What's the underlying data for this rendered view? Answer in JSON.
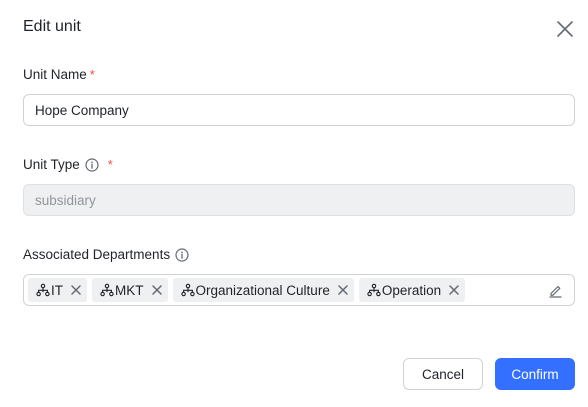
{
  "dialog": {
    "title": "Edit unit",
    "close_icon": "close-icon"
  },
  "unit_name": {
    "label": "Unit Name",
    "required_mark": "*",
    "value": "Hope Company"
  },
  "unit_type": {
    "label": "Unit Type",
    "required_mark": "*",
    "info_icon": "info-icon",
    "value": "subsidiary"
  },
  "associated_departments": {
    "label": "Associated Departments",
    "info_icon": "info-icon",
    "tags": [
      {
        "label": "IT",
        "icon": "department-icon"
      },
      {
        "label": "MKT",
        "icon": "department-icon"
      },
      {
        "label": "Organizational Culture",
        "icon": "department-icon"
      },
      {
        "label": "Operation",
        "icon": "department-icon"
      }
    ],
    "edit_icon": "edit-icon"
  },
  "footer": {
    "cancel_label": "Cancel",
    "confirm_label": "Confirm"
  },
  "colors": {
    "primary": "#3370ff",
    "required": "#f54a45",
    "disabled_bg": "#eff0f1",
    "border": "#d0d3d6"
  }
}
